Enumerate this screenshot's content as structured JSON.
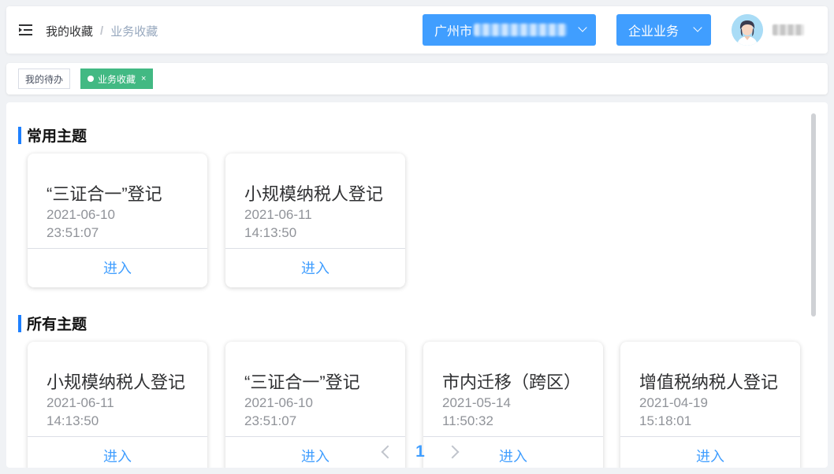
{
  "breadcrumb": {
    "home": "我的收藏",
    "separator": "/",
    "current": "业务收藏"
  },
  "header": {
    "city_select": {
      "label": "广州市"
    },
    "biz_select": {
      "label": "企业业务"
    }
  },
  "tags": [
    {
      "label": "我的待办",
      "active": false
    },
    {
      "label": "业务收藏",
      "active": true,
      "close": "×"
    }
  ],
  "sections": {
    "common": {
      "title": "常用主题",
      "cards": [
        {
          "title": "“三证合一”登记",
          "date": "2021-06-10",
          "time": "23:51:07",
          "action": "进入"
        },
        {
          "title": "小规模纳税人登记",
          "date": "2021-06-11",
          "time": "14:13:50",
          "action": "进入"
        }
      ]
    },
    "all": {
      "title": "所有主题",
      "cards": [
        {
          "title": "小规模纳税人登记",
          "date": "2021-06-11",
          "time": "14:13:50",
          "action": "进入"
        },
        {
          "title": "“三证合一”登记",
          "date": "2021-06-10",
          "time": "23:51:07",
          "action": "进入"
        },
        {
          "title": "市内迁移（跨区）",
          "date": "2021-05-14",
          "time": "11:50:32",
          "action": "进入"
        },
        {
          "title": "增值税纳税人登记",
          "date": "2021-04-19",
          "time": "15:18:01",
          "action": "进入"
        }
      ]
    }
  },
  "pagination": {
    "current": "1"
  },
  "colors": {
    "primary": "#409eff",
    "tag_active": "#42b983",
    "section_bar": "#1e80ff"
  }
}
